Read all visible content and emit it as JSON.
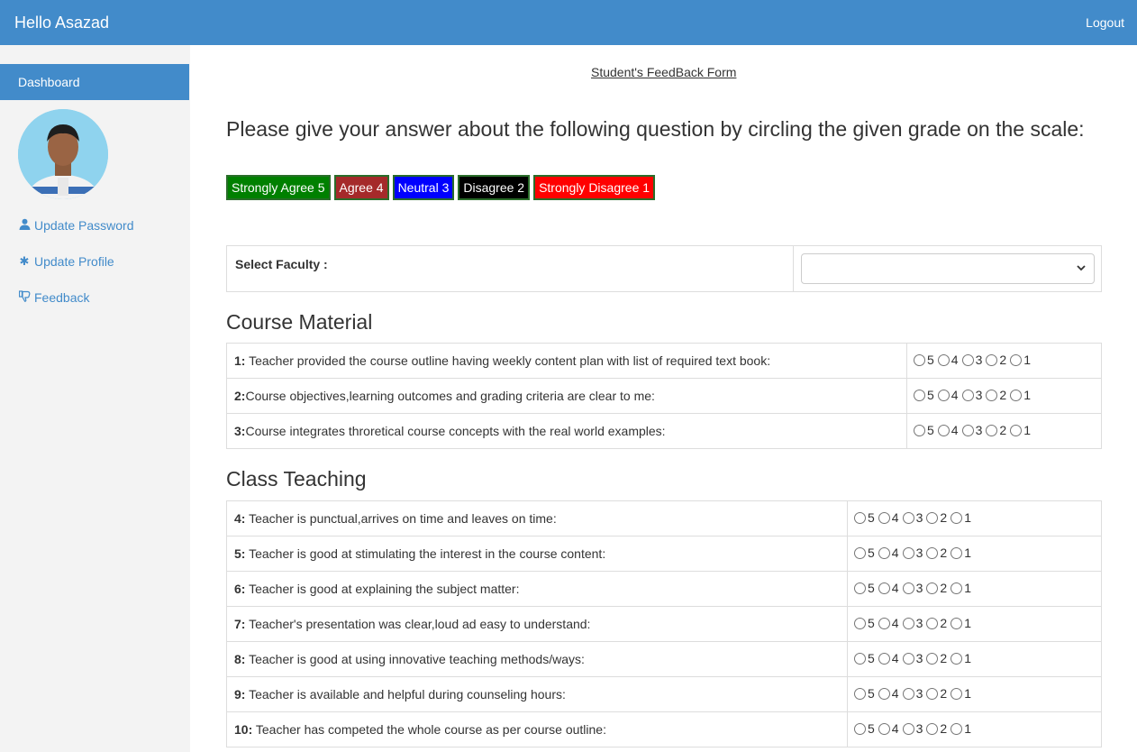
{
  "header": {
    "greeting": "Hello Asazad",
    "logout": "Logout"
  },
  "sidebar": {
    "dashboard": "Dashboard",
    "items": [
      {
        "label": "Update Password",
        "icon": "user-icon"
      },
      {
        "label": "Update Profile",
        "icon": "asterisk-icon"
      },
      {
        "label": "Feedback",
        "icon": "thumbs-down-icon"
      }
    ]
  },
  "form": {
    "title": "Student's FeedBack Form",
    "instructions": "Please give your answer about the following question by circling the given grade on the scale:",
    "legend": [
      {
        "label": "Strongly Agree 5",
        "color": "#008000"
      },
      {
        "label": "Agree 4",
        "color": "#a52a2a"
      },
      {
        "label": "Neutral 3",
        "color": "#0000ff"
      },
      {
        "label": "Disagree 2",
        "color": "#000000"
      },
      {
        "label": "Strongly Disagree 1",
        "color": "#ff0000"
      }
    ],
    "faculty_label": "Select Faculty :",
    "faculty_value": "",
    "options": [
      "5",
      "4",
      "3",
      "2",
      "1"
    ]
  },
  "sections": [
    {
      "title": "Course Material",
      "questions": [
        {
          "num": "1:",
          "text": " Teacher provided the course outline having weekly content plan with list of required text book:"
        },
        {
          "num": "2:",
          "text": "Course objectives,learning outcomes and grading criteria are clear to me:"
        },
        {
          "num": "3:",
          "text": "Course integrates throretical course concepts with the real world examples:"
        }
      ]
    },
    {
      "title": "Class Teaching",
      "questions": [
        {
          "num": "4:",
          "text": " Teacher is punctual,arrives on time and leaves on time:"
        },
        {
          "num": "5:",
          "text": " Teacher is good at stimulating the interest in the course content:"
        },
        {
          "num": "6:",
          "text": " Teacher is good at explaining the subject matter:"
        },
        {
          "num": "7:",
          "text": " Teacher's presentation was clear,loud ad easy to understand:"
        },
        {
          "num": "8:",
          "text": " Teacher is good at using innovative teaching methods/ways:"
        },
        {
          "num": "9:",
          "text": " Teacher is available and helpful during counseling hours:"
        },
        {
          "num": "10:",
          "text": " Teacher has competed the whole course as per course outline:"
        }
      ]
    }
  ]
}
